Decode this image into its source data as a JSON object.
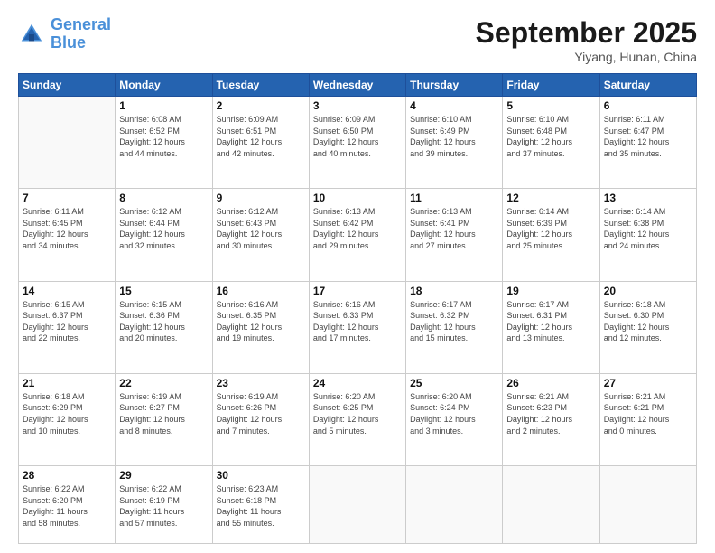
{
  "logo": {
    "line1": "General",
    "line2": "Blue"
  },
  "title": "September 2025",
  "subtitle": "Yiyang, Hunan, China",
  "weekdays": [
    "Sunday",
    "Monday",
    "Tuesday",
    "Wednesday",
    "Thursday",
    "Friday",
    "Saturday"
  ],
  "weeks": [
    [
      {
        "day": "",
        "info": ""
      },
      {
        "day": "1",
        "info": "Sunrise: 6:08 AM\nSunset: 6:52 PM\nDaylight: 12 hours\nand 44 minutes."
      },
      {
        "day": "2",
        "info": "Sunrise: 6:09 AM\nSunset: 6:51 PM\nDaylight: 12 hours\nand 42 minutes."
      },
      {
        "day": "3",
        "info": "Sunrise: 6:09 AM\nSunset: 6:50 PM\nDaylight: 12 hours\nand 40 minutes."
      },
      {
        "day": "4",
        "info": "Sunrise: 6:10 AM\nSunset: 6:49 PM\nDaylight: 12 hours\nand 39 minutes."
      },
      {
        "day": "5",
        "info": "Sunrise: 6:10 AM\nSunset: 6:48 PM\nDaylight: 12 hours\nand 37 minutes."
      },
      {
        "day": "6",
        "info": "Sunrise: 6:11 AM\nSunset: 6:47 PM\nDaylight: 12 hours\nand 35 minutes."
      }
    ],
    [
      {
        "day": "7",
        "info": "Sunrise: 6:11 AM\nSunset: 6:45 PM\nDaylight: 12 hours\nand 34 minutes."
      },
      {
        "day": "8",
        "info": "Sunrise: 6:12 AM\nSunset: 6:44 PM\nDaylight: 12 hours\nand 32 minutes."
      },
      {
        "day": "9",
        "info": "Sunrise: 6:12 AM\nSunset: 6:43 PM\nDaylight: 12 hours\nand 30 minutes."
      },
      {
        "day": "10",
        "info": "Sunrise: 6:13 AM\nSunset: 6:42 PM\nDaylight: 12 hours\nand 29 minutes."
      },
      {
        "day": "11",
        "info": "Sunrise: 6:13 AM\nSunset: 6:41 PM\nDaylight: 12 hours\nand 27 minutes."
      },
      {
        "day": "12",
        "info": "Sunrise: 6:14 AM\nSunset: 6:39 PM\nDaylight: 12 hours\nand 25 minutes."
      },
      {
        "day": "13",
        "info": "Sunrise: 6:14 AM\nSunset: 6:38 PM\nDaylight: 12 hours\nand 24 minutes."
      }
    ],
    [
      {
        "day": "14",
        "info": "Sunrise: 6:15 AM\nSunset: 6:37 PM\nDaylight: 12 hours\nand 22 minutes."
      },
      {
        "day": "15",
        "info": "Sunrise: 6:15 AM\nSunset: 6:36 PM\nDaylight: 12 hours\nand 20 minutes."
      },
      {
        "day": "16",
        "info": "Sunrise: 6:16 AM\nSunset: 6:35 PM\nDaylight: 12 hours\nand 19 minutes."
      },
      {
        "day": "17",
        "info": "Sunrise: 6:16 AM\nSunset: 6:33 PM\nDaylight: 12 hours\nand 17 minutes."
      },
      {
        "day": "18",
        "info": "Sunrise: 6:17 AM\nSunset: 6:32 PM\nDaylight: 12 hours\nand 15 minutes."
      },
      {
        "day": "19",
        "info": "Sunrise: 6:17 AM\nSunset: 6:31 PM\nDaylight: 12 hours\nand 13 minutes."
      },
      {
        "day": "20",
        "info": "Sunrise: 6:18 AM\nSunset: 6:30 PM\nDaylight: 12 hours\nand 12 minutes."
      }
    ],
    [
      {
        "day": "21",
        "info": "Sunrise: 6:18 AM\nSunset: 6:29 PM\nDaylight: 12 hours\nand 10 minutes."
      },
      {
        "day": "22",
        "info": "Sunrise: 6:19 AM\nSunset: 6:27 PM\nDaylight: 12 hours\nand 8 minutes."
      },
      {
        "day": "23",
        "info": "Sunrise: 6:19 AM\nSunset: 6:26 PM\nDaylight: 12 hours\nand 7 minutes."
      },
      {
        "day": "24",
        "info": "Sunrise: 6:20 AM\nSunset: 6:25 PM\nDaylight: 12 hours\nand 5 minutes."
      },
      {
        "day": "25",
        "info": "Sunrise: 6:20 AM\nSunset: 6:24 PM\nDaylight: 12 hours\nand 3 minutes."
      },
      {
        "day": "26",
        "info": "Sunrise: 6:21 AM\nSunset: 6:23 PM\nDaylight: 12 hours\nand 2 minutes."
      },
      {
        "day": "27",
        "info": "Sunrise: 6:21 AM\nSunset: 6:21 PM\nDaylight: 12 hours\nand 0 minutes."
      }
    ],
    [
      {
        "day": "28",
        "info": "Sunrise: 6:22 AM\nSunset: 6:20 PM\nDaylight: 11 hours\nand 58 minutes."
      },
      {
        "day": "29",
        "info": "Sunrise: 6:22 AM\nSunset: 6:19 PM\nDaylight: 11 hours\nand 57 minutes."
      },
      {
        "day": "30",
        "info": "Sunrise: 6:23 AM\nSunset: 6:18 PM\nDaylight: 11 hours\nand 55 minutes."
      },
      {
        "day": "",
        "info": ""
      },
      {
        "day": "",
        "info": ""
      },
      {
        "day": "",
        "info": ""
      },
      {
        "day": "",
        "info": ""
      }
    ]
  ]
}
